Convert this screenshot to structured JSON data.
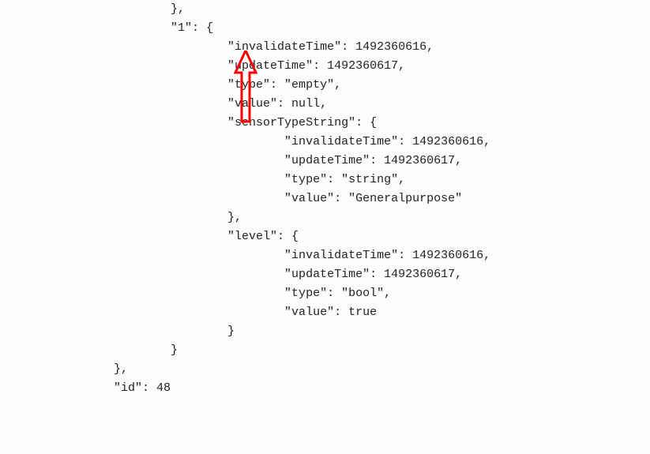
{
  "code": {
    "l1": "                        },",
    "l2": "                        \"1\": {",
    "l3": "                                \"invalidateTime\": 1492360616,",
    "l4": "                                \"updateTime\": 1492360617,",
    "l5": "                                \"type\": \"empty\",",
    "l6": "                                \"value\": null,",
    "l7": "                                \"sensorTypeString\": {",
    "l8": "                                        \"invalidateTime\": 1492360616,",
    "l9": "                                        \"updateTime\": 1492360617,",
    "l10": "                                        \"type\": \"string\",",
    "l11": "                                        \"value\": \"Generalpurpose\"",
    "l12": "                                },",
    "l13": "                                \"level\": {",
    "l14": "                                        \"invalidateTime\": 1492360616,",
    "l15": "                                        \"updateTime\": 1492360617,",
    "l16": "                                        \"type\": \"bool\",",
    "l17": "                                        \"value\": true",
    "l18": "                                }",
    "l19": "                        }",
    "l20": "                },",
    "l21": "                \"id\": 48"
  }
}
